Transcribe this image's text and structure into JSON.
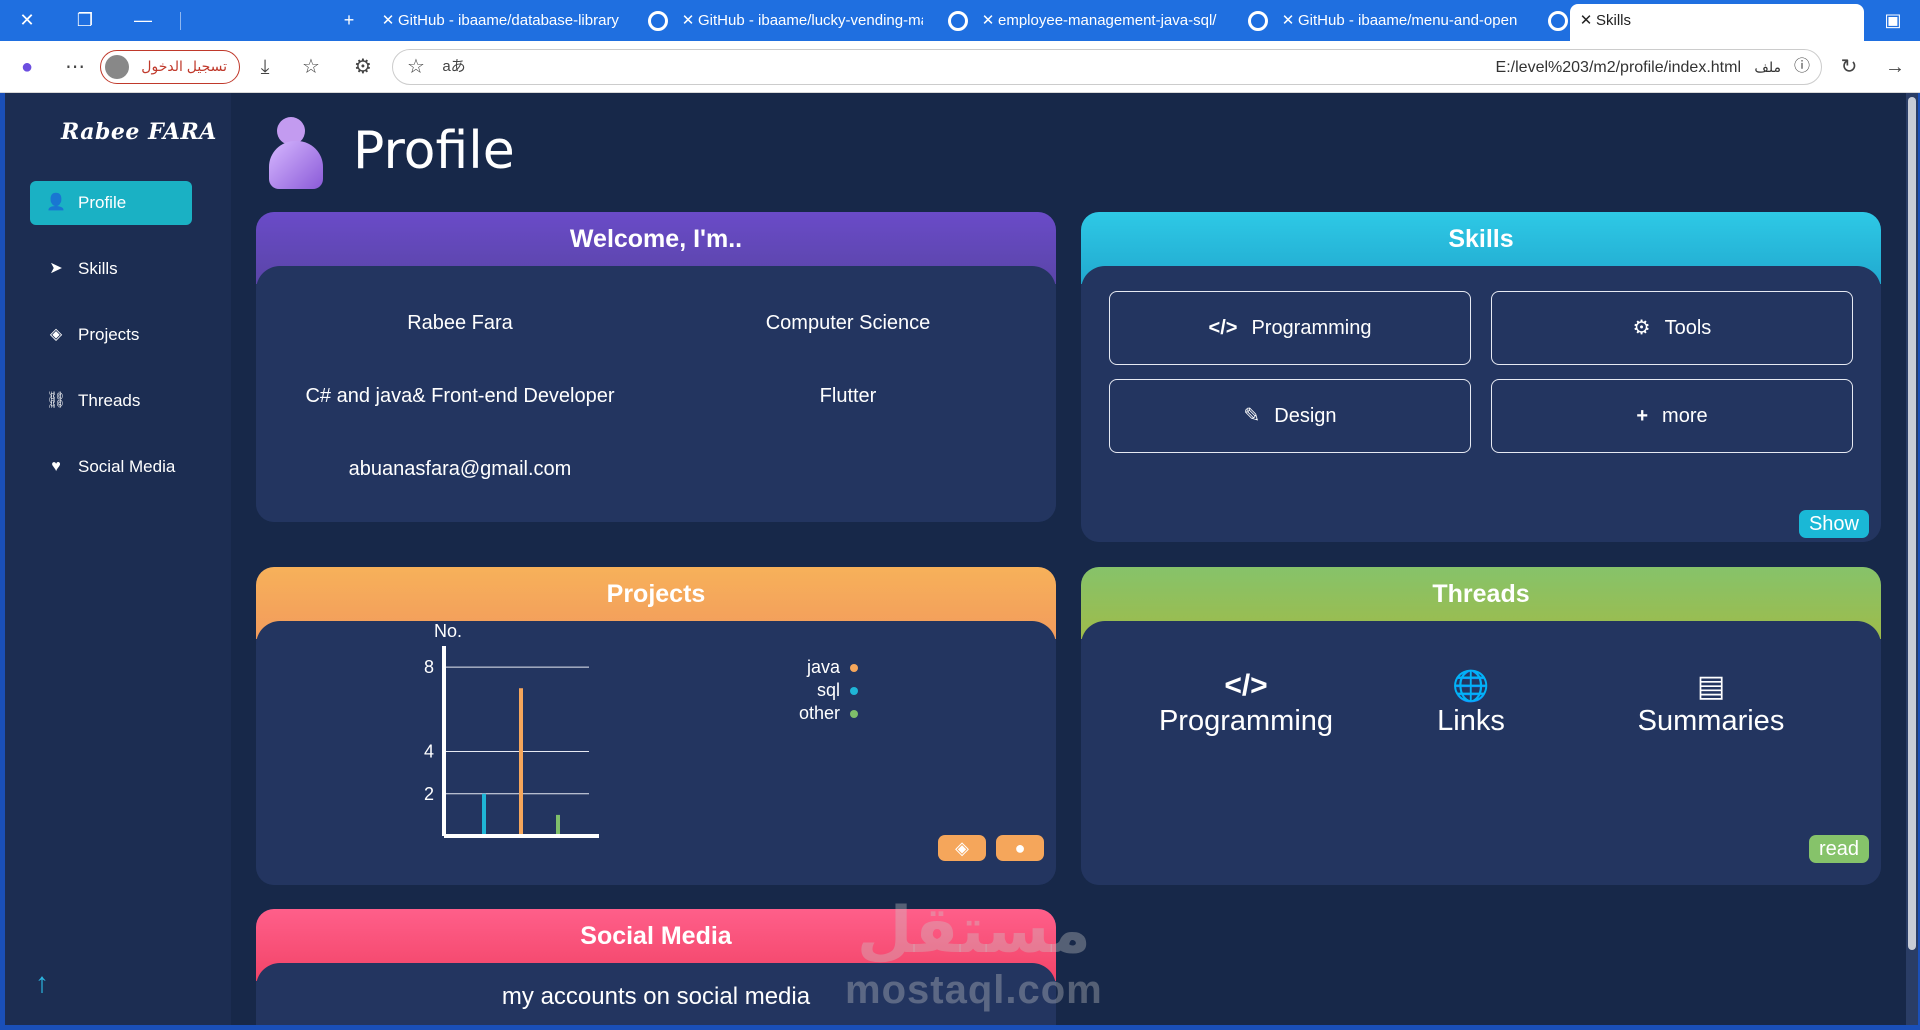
{
  "browser": {
    "tabs": [
      {
        "title": "GitHub - ibaame/database-library"
      },
      {
        "title": "GitHub - ibaame/lucky-vending-machine"
      },
      {
        "title": "employee-management-java-sql/"
      },
      {
        "title": "GitHub - ibaame/menu-and-open"
      },
      {
        "title": "Skills"
      }
    ],
    "login_label": "تسجيل الدخول",
    "url": "E:/level%203/m2/profile/index.html",
    "file_label": "ملف",
    "read_aloud": "aあ"
  },
  "sidebar": {
    "brand": "Rabee FARA",
    "items": [
      {
        "label": "Profile",
        "icon": "user-icon"
      },
      {
        "label": "Skills",
        "icon": "send-icon"
      },
      {
        "label": "Projects",
        "icon": "codepen-icon"
      },
      {
        "label": "Threads",
        "icon": "diagram-icon"
      },
      {
        "label": "Social Media",
        "icon": "heart-icon"
      }
    ]
  },
  "page": {
    "title": "Profile"
  },
  "welcome": {
    "title": "Welcome, I'm..",
    "name": "Rabee Fara",
    "field": "Computer Science",
    "role": "C# and java& Front-end Developer",
    "framework": "Flutter",
    "email": "abuanasfara@gmail.com"
  },
  "skills": {
    "title": "Skills",
    "buttons": [
      {
        "label": "Programming",
        "icon": "code-icon"
      },
      {
        "label": "Tools",
        "icon": "gears-icon"
      },
      {
        "label": "Design",
        "icon": "brush-icon"
      },
      {
        "label": "more",
        "icon": "plus-icon"
      }
    ],
    "show_label": "Show"
  },
  "projects": {
    "title": "Projects"
  },
  "chart_data": {
    "type": "bar",
    "ylabel": "No.",
    "yticks": [
      2,
      4,
      8
    ],
    "ylim": [
      0,
      9
    ],
    "series": [
      {
        "name": "sql",
        "value": 2,
        "color": "#1fb5d6"
      },
      {
        "name": "java",
        "value": 7,
        "color": "#f5a65b"
      },
      {
        "name": "other",
        "value": 1,
        "color": "#7fbf6a"
      }
    ],
    "legend": [
      {
        "name": "java",
        "color": "#f5a65b"
      },
      {
        "name": "sql",
        "color": "#1fb5d6"
      },
      {
        "name": "other",
        "color": "#7fbf6a"
      }
    ],
    "grid": true
  },
  "threads": {
    "title": "Threads",
    "items": [
      {
        "label": "Programming",
        "icon": "code-icon"
      },
      {
        "label": "Links",
        "icon": "globe-icon"
      },
      {
        "label": "Summaries",
        "icon": "book-icon"
      }
    ],
    "read_label": "read"
  },
  "social": {
    "title": "Social Media",
    "subtitle": "my accounts on social media"
  },
  "watermark": {
    "arabic": "مستقل",
    "latin": "mostaql.com"
  },
  "colors": {
    "page_bg": "#172849",
    "card_bg": "#233560",
    "accent": "#1ab1c4"
  }
}
